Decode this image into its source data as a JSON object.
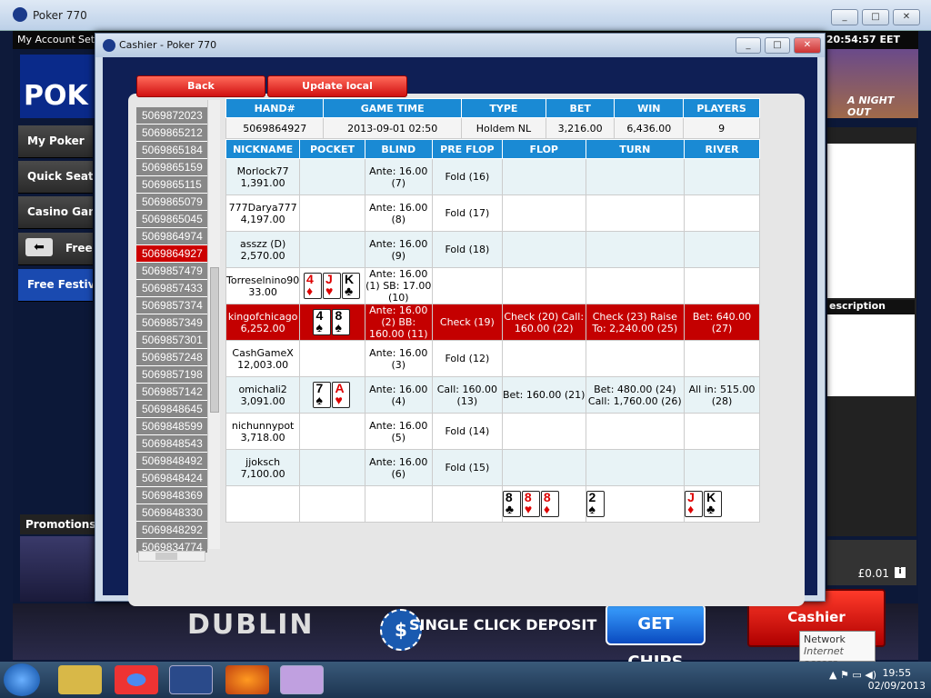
{
  "outer": {
    "title": "Poker 770",
    "menu": [
      "My Account",
      "Set"
    ],
    "clock": "2 20:54:57  EET"
  },
  "nav": [
    "My Poker",
    "Quick Seat",
    "Casino Gam",
    "Free",
    "Free Festiva"
  ],
  "promotions": "Promotions",
  "dialog": {
    "title": "Cashier - Poker 770",
    "back": "Back",
    "update": "Update local information"
  },
  "hand_list": [
    "5069872023",
    "5069865212",
    "5069865184",
    "5069865159",
    "5069865115",
    "5069865079",
    "5069865045",
    "5069864974",
    "5069864927",
    "5069857479",
    "5069857433",
    "5069857374",
    "5069857349",
    "5069857301",
    "5069857248",
    "5069857198",
    "5069857142",
    "5069848645",
    "5069848599",
    "5069848543",
    "5069848492",
    "5069848424",
    "5069848369",
    "5069848330",
    "5069848292",
    "5069834774"
  ],
  "summary": {
    "headers": [
      "HAND#",
      "GAME TIME",
      "TYPE",
      "BET",
      "WIN",
      "PLAYERS"
    ],
    "values": [
      "5069864927",
      "2013-09-01 02:50",
      "Holdem NL",
      "3,216.00",
      "6,436.00",
      "9"
    ]
  },
  "detail_headers": [
    "NICKNAME",
    "POCKET",
    "BLIND",
    "PRE FLOP",
    "FLOP",
    "TURN",
    "RIVER"
  ],
  "rows": [
    {
      "name": "Morlock77",
      "chips": "1,391.00",
      "blind": "Ante: 16.00 (7)",
      "preflop": "Fold (16)",
      "flop": "",
      "turn": "",
      "river": ""
    },
    {
      "name": "777Darya777",
      "chips": "4,197.00",
      "blind": "Ante: 16.00 (8)",
      "preflop": "Fold (17)",
      "flop": "",
      "turn": "",
      "river": ""
    },
    {
      "name": "asszz (D)",
      "chips": "2,570.00",
      "blind": "Ante: 16.00 (9)",
      "preflop": "Fold (18)",
      "flop": "",
      "turn": "",
      "river": ""
    },
    {
      "name": "Torreselnino90",
      "chips": "33.00",
      "blind": "Ante: 16.00 (1) SB: 17.00 (10)",
      "preflop": "",
      "flop": "",
      "turn": "",
      "river": ""
    },
    {
      "name": "kingofchicago",
      "chips": "6,252.00",
      "blind": "Ante: 16.00 (2) BB: 160.00 (11)",
      "preflop": "Check (19)",
      "flop": "Check (20) Call: 160.00 (22)",
      "turn": "Check (23) Raise To: 2,240.00 (25)",
      "river": "Bet: 640.00 (27)"
    },
    {
      "name": "CashGameX",
      "chips": "12,003.00",
      "blind": "Ante: 16.00 (3)",
      "preflop": "Fold (12)",
      "flop": "",
      "turn": "",
      "river": ""
    },
    {
      "name": "omichali2",
      "chips": "3,091.00",
      "blind": "Ante: 16.00 (4)",
      "preflop": "Call: 160.00 (13)",
      "flop": "Bet: 160.00 (21)",
      "turn": "Bet: 480.00 (24) Call: 1,760.00 (26)",
      "river": "All in: 515.00 (28)"
    },
    {
      "name": "nichunnypot",
      "chips": "3,718.00",
      "blind": "Ante: 16.00 (5)",
      "preflop": "Fold (14)",
      "flop": "",
      "turn": "",
      "river": ""
    },
    {
      "name": "jjoksch",
      "chips": "7,100.00",
      "blind": "Ante: 16.00 (6)",
      "preflop": "Fold (15)",
      "flop": "",
      "turn": "",
      "river": ""
    }
  ],
  "pockets": {
    "Torreselnino90": [
      [
        "4",
        "♦",
        "red"
      ],
      [
        "J",
        "♥",
        "red"
      ],
      [
        "K",
        "♣",
        "blk"
      ]
    ],
    "kingofchicago": [
      [
        "4",
        "♠",
        "blk"
      ],
      [
        "8",
        "♠",
        "blk"
      ]
    ],
    "omichali2": [
      [
        "7",
        "♠",
        "blk"
      ],
      [
        "A",
        "♥",
        "red"
      ]
    ]
  },
  "board": {
    "flop": [
      [
        "8",
        "♣",
        "blk"
      ],
      [
        "8",
        "♥",
        "red"
      ],
      [
        "8",
        "♦",
        "red"
      ]
    ],
    "turn": [
      [
        "2",
        "♠",
        "blk"
      ]
    ],
    "river": [
      [
        "J",
        "♦",
        "red"
      ],
      [
        "K",
        "♣",
        "blk"
      ]
    ]
  },
  "right": {
    "promo": "A NIGHT OUT",
    "desc": "escription",
    "balance": "£0.01",
    "cashier": "Cashier",
    "tooltip1": "Network",
    "tooltip2": "Internet access"
  },
  "banner": {
    "dublin": "DUBLIN",
    "deposit": "SINGLE CLICK DEPOSIT",
    "getchips": "GET CHIPS"
  },
  "taskbar": {
    "time": "19:55",
    "date": "02/09/2013"
  }
}
